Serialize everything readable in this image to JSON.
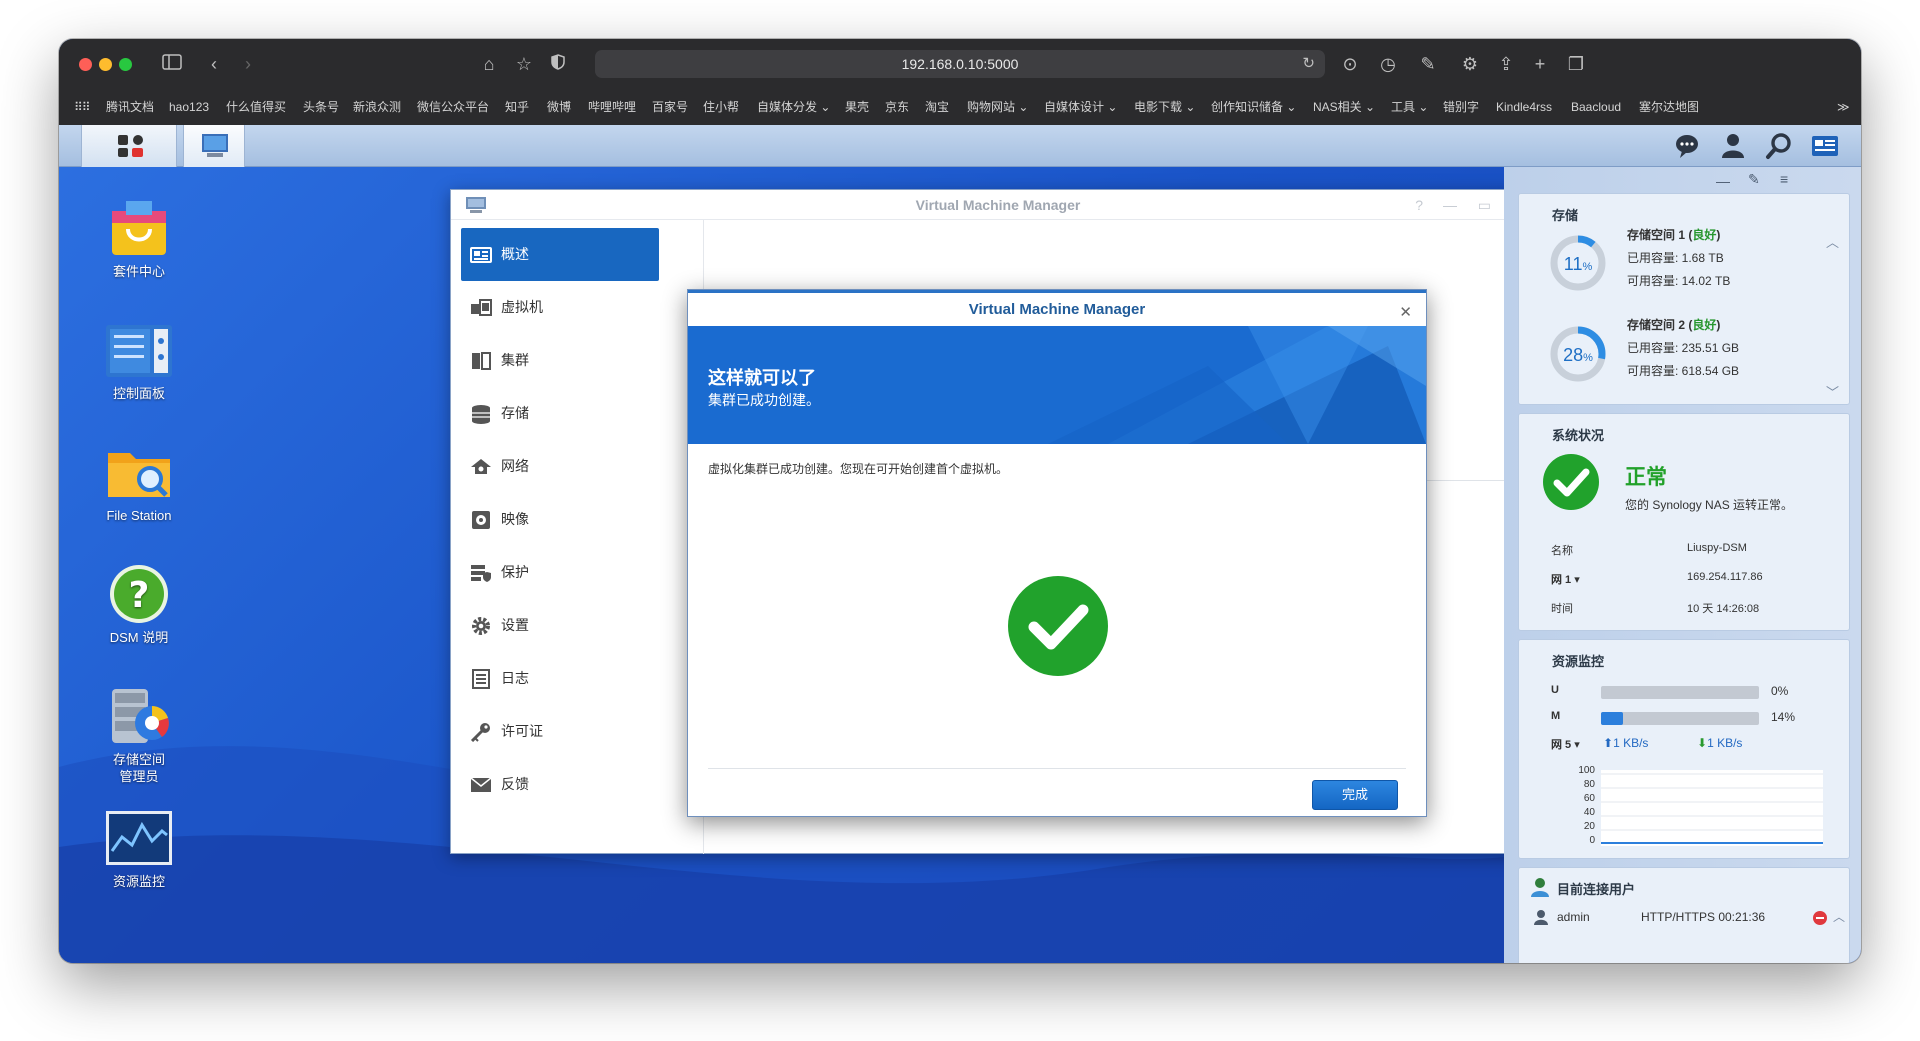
{
  "browser": {
    "url": "192.168.0.10:5000",
    "bookmarks": [
      "腾讯文档",
      "hao123",
      "什么值得买",
      "头条号",
      "新浪众测",
      "微信公众平台",
      "知乎",
      "微博",
      "哔哩哔哩",
      "百家号",
      "住小帮",
      "自媒体分发 ⌄",
      "果壳",
      "京东",
      "淘宝",
      "购物网站 ⌄",
      "自媒体设计 ⌄",
      "电影下载 ⌄",
      "创作知识储备 ⌄",
      "NAS相关 ⌄",
      "工具 ⌄",
      "错别字",
      "Kindle4rss",
      "Baacloud",
      "塞尔达地图"
    ],
    "more": "≫"
  },
  "desktop_icons": [
    {
      "label": "套件中心"
    },
    {
      "label": "控制面板"
    },
    {
      "label": "File Station"
    },
    {
      "label": "DSM 说明"
    },
    {
      "label": "存储空间\n管理员"
    },
    {
      "label": "资源监控"
    }
  ],
  "vmm": {
    "title": "Virtual Machine Manager",
    "window_controls": [
      "?",
      "—",
      "▭",
      "✕"
    ],
    "nav": [
      {
        "label": "概述",
        "active": true
      },
      {
        "label": "虚拟机"
      },
      {
        "label": "集群"
      },
      {
        "label": "存储"
      },
      {
        "label": "网络"
      },
      {
        "label": "映像"
      },
      {
        "label": "保护"
      },
      {
        "label": "设置"
      },
      {
        "label": "日志"
      },
      {
        "label": "许可证"
      },
      {
        "label": "反馈"
      }
    ]
  },
  "dialog": {
    "title": "Virtual Machine Manager",
    "close": "✕",
    "heading": "这样就可以了",
    "subheading": "集群已成功创建。",
    "message": "虚拟化集群已成功创建。您现在可开始创建首个虚拟机。",
    "done_button": "完成"
  },
  "widgets": {
    "storage": {
      "title": "存储",
      "volumes": [
        {
          "name": "存储空间 1 (",
          "status": "良好",
          "close": ")",
          "percent": "11",
          "used": "已用容量: 1.68 TB",
          "free": "可用容量: 14.02 TB",
          "fill": 0.11
        },
        {
          "name": "存储空间 2 (",
          "status": "良好",
          "close": ")",
          "percent": "28",
          "used": "已用容量: 235.51 GB",
          "free": "可用容量: 618.54 GB",
          "fill": 0.28
        }
      ]
    },
    "system": {
      "title": "系统状况",
      "status": "正常",
      "desc": "您的 Synology NAS 运转正常。",
      "rows": [
        {
          "k": "名称",
          "v": "Liuspy-DSM"
        },
        {
          "k": "网 1 ▾",
          "v": "169.254.117.86"
        },
        {
          "k": "时间",
          "v": "10 天 14:26:08"
        }
      ]
    },
    "monitor": {
      "title": "资源监控",
      "cpu_label": "U",
      "cpu_value": "0%",
      "cpu_fill": 0.0,
      "ram_label": "M",
      "ram_value": "14%",
      "ram_fill": 0.14,
      "net_label": "网 5 ▾",
      "up": "1 KB/s",
      "down": "1 KB/s",
      "yticks": [
        "100",
        "80",
        "60",
        "40",
        "20",
        "0"
      ]
    },
    "users": {
      "title": "目前连接用户",
      "rows": [
        {
          "name": "admin",
          "proto": "HTTP/HTTPS 00:21:36"
        }
      ]
    }
  }
}
